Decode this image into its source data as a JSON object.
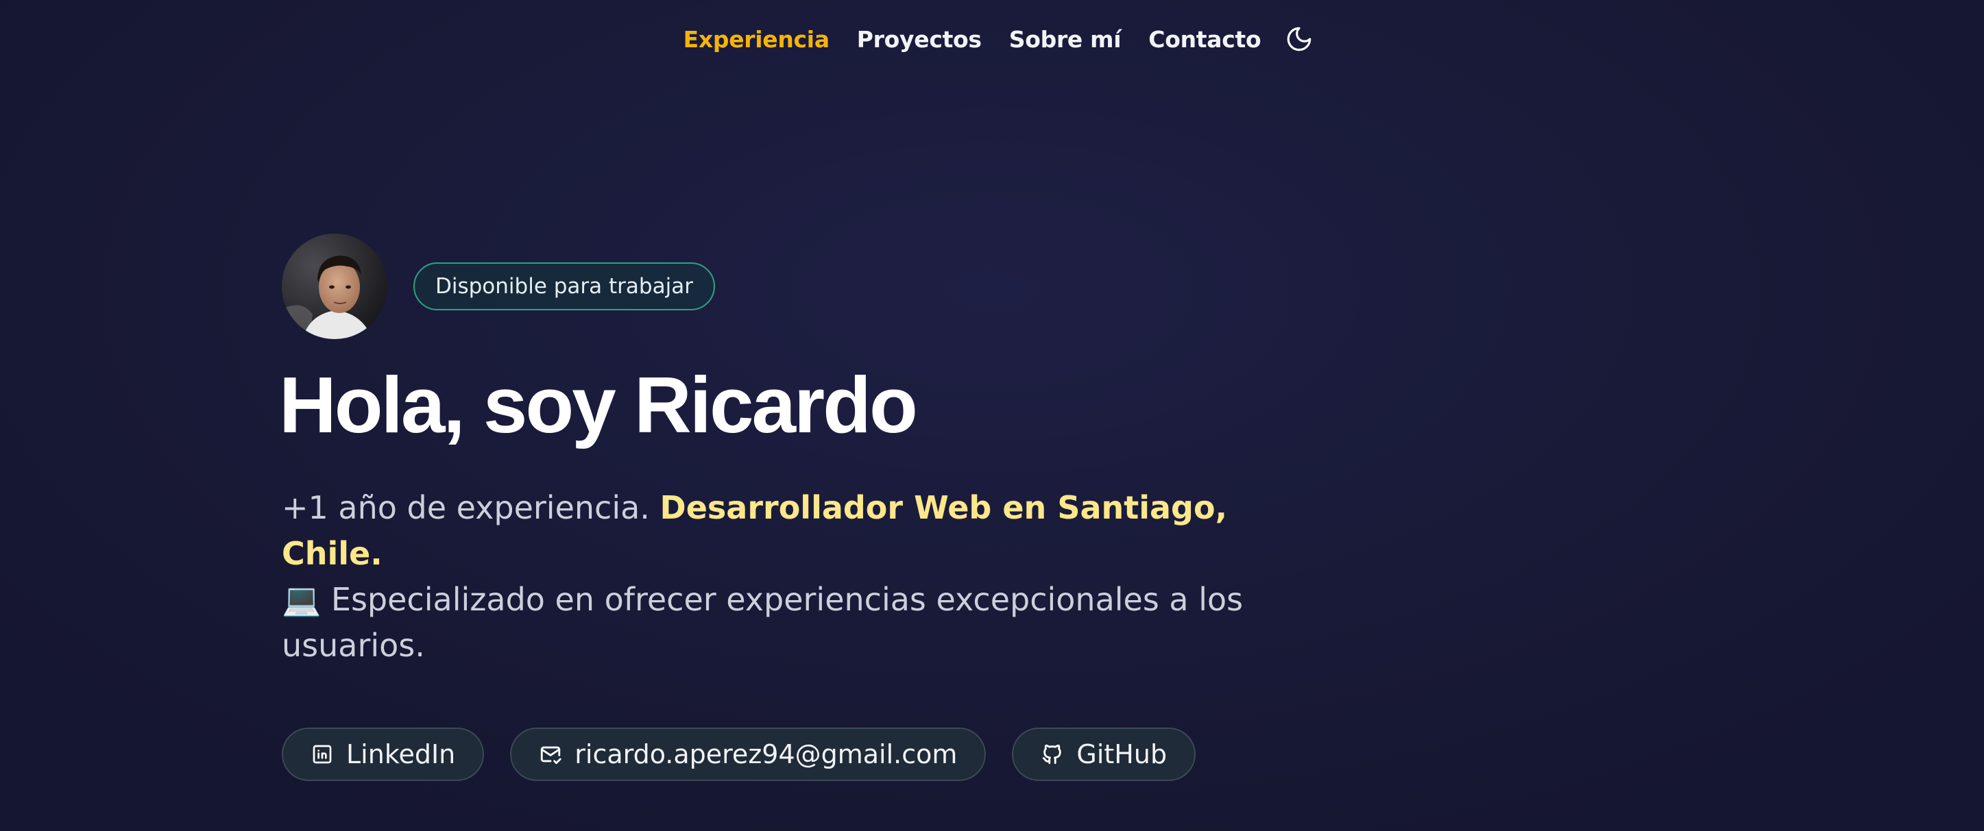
{
  "nav": {
    "items": [
      {
        "label": "Experiencia",
        "active": true
      },
      {
        "label": "Proyectos",
        "active": false
      },
      {
        "label": "Sobre mí",
        "active": false
      },
      {
        "label": "Contacto",
        "active": false
      }
    ],
    "theme_icon": "moon-icon",
    "active_color": "#f5b40b"
  },
  "hero": {
    "availability_badge": "Disponible para trabajar",
    "title": "Hola, soy Ricardo",
    "desc_intro": "+1 año de experiencia.",
    "desc_highlight": "Desarrollador Web en Santiago, Chile.",
    "desc_emoji": "💻",
    "desc_rest": "Especializado en ofrecer experiencias excepcionales a los usuarios.",
    "highlight_color": "#fde78b"
  },
  "links": [
    {
      "label": "LinkedIn",
      "icon": "linkedin-icon"
    },
    {
      "label": "ricardo.aperez94@gmail.com",
      "icon": "mail-icon"
    },
    {
      "label": "GitHub",
      "icon": "github-icon"
    }
  ]
}
